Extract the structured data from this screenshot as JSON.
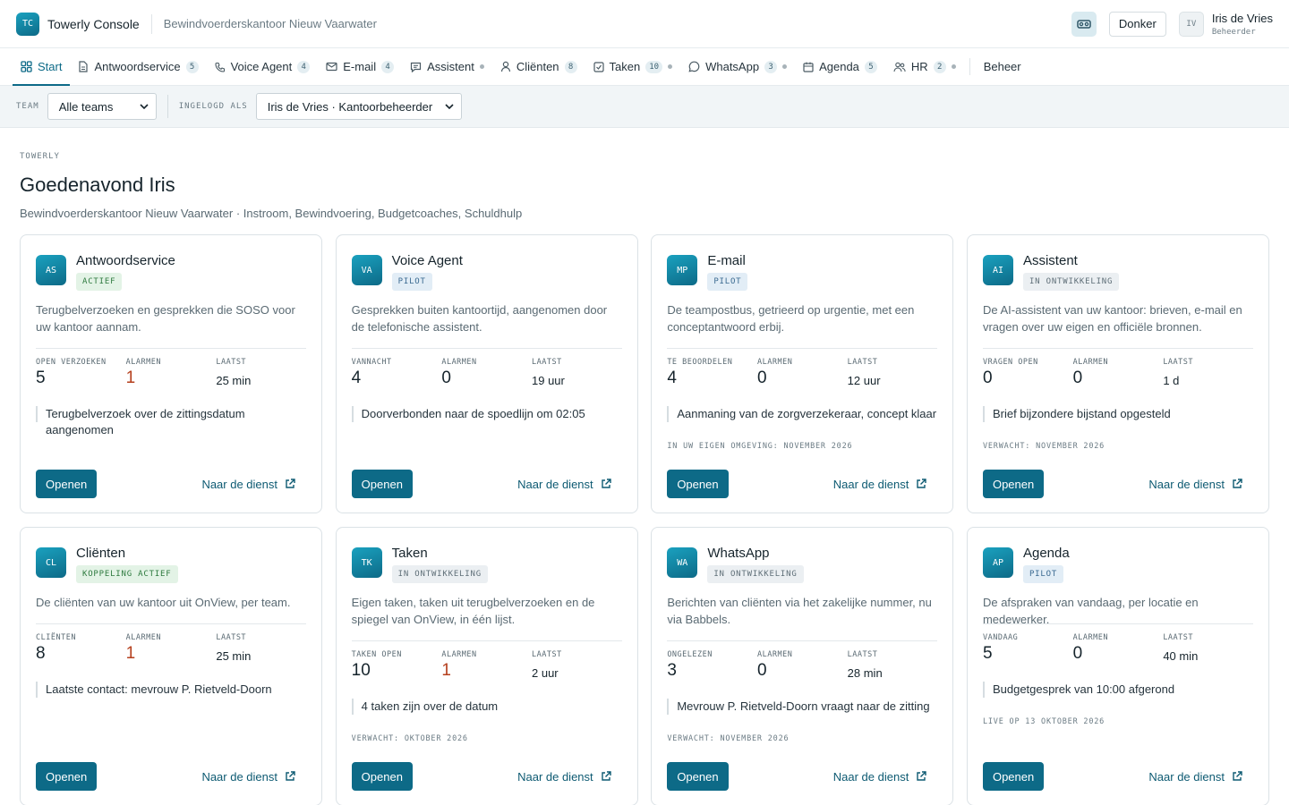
{
  "header": {
    "logo_initials": "TC",
    "app_name": "Towerly Console",
    "org_name": "Bewindvoerderskantoor Nieuw Vaarwater",
    "theme_button": "Donker",
    "user": {
      "initials": "IV",
      "name": "Iris de Vries",
      "role": "Beheerder"
    }
  },
  "nav": {
    "items": [
      {
        "label": "Start",
        "icon": "grid-icon",
        "active": true
      },
      {
        "label": "Antwoordservice",
        "icon": "document-icon",
        "count": "5"
      },
      {
        "label": "Voice Agent",
        "icon": "phone-icon",
        "count": "4"
      },
      {
        "label": "E-mail",
        "icon": "mail-icon",
        "count": "4"
      },
      {
        "label": "Assistent",
        "icon": "chat-icon",
        "dot": true
      },
      {
        "label": "Cliënten",
        "icon": "person-icon",
        "count": "8"
      },
      {
        "label": "Taken",
        "icon": "checkbox-icon",
        "count": "10",
        "dot": true
      },
      {
        "label": "WhatsApp",
        "icon": "whatsapp-icon",
        "count": "3",
        "dot": true
      },
      {
        "label": "Agenda",
        "icon": "calendar-icon",
        "count": "5"
      },
      {
        "label": "HR",
        "icon": "people-icon",
        "count": "2",
        "dot": true
      }
    ],
    "admin_label": "Beheer"
  },
  "filters": {
    "team_label": "TEAM",
    "team_value": "Alle teams",
    "login_label": "INGELOGD ALS",
    "login_value": "Iris de Vries · Kantoorbeheerder"
  },
  "page": {
    "eyebrow": "TOWERLY",
    "greeting": "Goedenavond Iris",
    "subtitle": "Bewindvoerderskantoor Nieuw Vaarwater · Instroom, Bewindvoering, Budgetcoaches, Schuldhulp"
  },
  "cards": [
    {
      "initials": "AS",
      "title": "Antwoordservice",
      "status": "ACTIEF",
      "status_tone": "green",
      "desc": "Terugbelverzoeken en gesprekken die SOSO voor uw kantoor aannam.",
      "stat1_label": "OPEN VERZOEKEN",
      "stat1_value": "5",
      "stat2_label": "ALARMEN",
      "stat2_value": "1",
      "stat2_alarm": true,
      "stat3_label": "LAATST",
      "stat3_value": "25 min",
      "note": "Terugbelverzoek over de zittingsdatum aangenomen",
      "expect": "",
      "open_label": "Openen",
      "service_label": "Naar de dienst"
    },
    {
      "initials": "VA",
      "title": "Voice Agent",
      "status": "PILOT",
      "status_tone": "blue",
      "desc": "Gesprekken buiten kantoortijd, aangenomen door de telefonische assistent.",
      "stat1_label": "VANNACHT",
      "stat1_value": "4",
      "stat2_label": "ALARMEN",
      "stat2_value": "0",
      "stat2_alarm": false,
      "stat3_label": "LAATST",
      "stat3_value": "19 uur",
      "note": "Doorverbonden naar de spoedlijn om 02:05",
      "expect": "",
      "open_label": "Openen",
      "service_label": "Naar de dienst"
    },
    {
      "initials": "MP",
      "title": "E-mail",
      "status": "PILOT",
      "status_tone": "blue",
      "desc": "De teampostbus, getrieerd op urgentie, met een conceptantwoord erbij.",
      "stat1_label": "TE BEOORDELEN",
      "stat1_value": "4",
      "stat2_label": "ALARMEN",
      "stat2_value": "0",
      "stat2_alarm": false,
      "stat3_label": "LAATST",
      "stat3_value": "12 uur",
      "note": "Aanmaning van de zorgverzekeraar, concept klaar",
      "expect": "IN UW EIGEN OMGEVING: NOVEMBER 2026",
      "open_label": "Openen",
      "service_label": "Naar de dienst"
    },
    {
      "initials": "AI",
      "title": "Assistent",
      "status": "IN ONTWIKKELING",
      "status_tone": "grey",
      "desc": "De AI-assistent van uw kantoor: brieven, e-mail en vragen over uw eigen en officiële bronnen.",
      "stat1_label": "VRAGEN OPEN",
      "stat1_value": "0",
      "stat2_label": "ALARMEN",
      "stat2_value": "0",
      "stat2_alarm": false,
      "stat3_label": "LAATST",
      "stat3_value": "1 d",
      "note": "Brief bijzondere bijstand opgesteld",
      "expect": "VERWACHT: NOVEMBER 2026",
      "open_label": "Openen",
      "service_label": "Naar de dienst"
    },
    {
      "initials": "CL",
      "title": "Cliënten",
      "status": "KOPPELING ACTIEF",
      "status_tone": "green",
      "desc": "De cliënten van uw kantoor uit OnView, per team.",
      "stat1_label": "CLIËNTEN",
      "stat1_value": "8",
      "stat2_label": "ALARMEN",
      "stat2_value": "1",
      "stat2_alarm": true,
      "stat3_label": "LAATST",
      "stat3_value": "25 min",
      "note": "Laatste contact: mevrouw P. Rietveld-Doorn",
      "expect": "",
      "open_label": "Openen",
      "service_label": "Naar de dienst"
    },
    {
      "initials": "TK",
      "title": "Taken",
      "status": "IN ONTWIKKELING",
      "status_tone": "grey",
      "desc": "Eigen taken, taken uit terugbelverzoeken en de spiegel van OnView, in één lijst.",
      "stat1_label": "TAKEN OPEN",
      "stat1_value": "10",
      "stat2_label": "ALARMEN",
      "stat2_value": "1",
      "stat2_alarm": true,
      "stat3_label": "LAATST",
      "stat3_value": "2 uur",
      "note": "4 taken zijn over de datum",
      "expect": "VERWACHT: OKTOBER 2026",
      "open_label": "Openen",
      "service_label": "Naar de dienst"
    },
    {
      "initials": "WA",
      "title": "WhatsApp",
      "status": "IN ONTWIKKELING",
      "status_tone": "grey",
      "desc": "Berichten van cliënten via het zakelijke nummer, nu via Babbels.",
      "stat1_label": "ONGELEZEN",
      "stat1_value": "3",
      "stat2_label": "ALARMEN",
      "stat2_value": "0",
      "stat2_alarm": false,
      "stat3_label": "LAATST",
      "stat3_value": "28 min",
      "note": "Mevrouw P. Rietveld-Doorn vraagt naar de zitting",
      "expect": "VERWACHT: NOVEMBER 2026",
      "open_label": "Openen",
      "service_label": "Naar de dienst"
    },
    {
      "initials": "AP",
      "title": "Agenda",
      "status": "PILOT",
      "status_tone": "blue",
      "desc": "De afspraken van vandaag, per locatie en medewerker.",
      "stat1_label": "VANDAAG",
      "stat1_value": "5",
      "stat2_label": "ALARMEN",
      "stat2_value": "0",
      "stat2_alarm": false,
      "stat3_label": "LAATST",
      "stat3_value": "40 min",
      "note": "Budgetgesprek van 10:00 afgerond",
      "expect": "LIVE OP 13 OKTOBER 2026",
      "open_label": "Openen",
      "service_label": "Naar de dienst"
    }
  ]
}
